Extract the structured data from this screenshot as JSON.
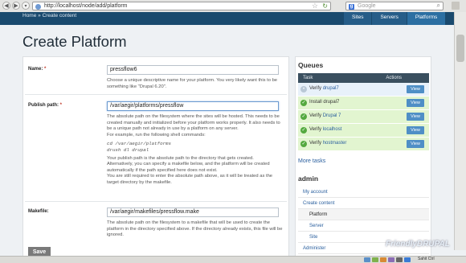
{
  "browser": {
    "url": "http://localhost/node/add/platform",
    "search_placeholder": "Google",
    "search_engine_letter": "g"
  },
  "breadcrumb": "Home » Create content",
  "tabs": [
    "Sites",
    "Servers",
    "Platforms"
  ],
  "page_title": "Create Platform",
  "form": {
    "name": {
      "label": "Name:",
      "value": "pressflow6",
      "description": "Choose a unique descriptive name for your platform. You very likely want this to be something like \"Drupal 6.20\"."
    },
    "publish_path": {
      "label": "Publish path:",
      "value": "/var/aegir/platforms/pressflow",
      "desc1": "The absolute path on the filesystem where the sites will be hosted. This needs to be created manually and initialized before your platform works properly. It also needs to be a unique path not already in use by a platform on any server.",
      "desc2": "For example, run the following shell commands:",
      "code1": "cd /var/aegir/platforms",
      "code2": "drush dl drupal",
      "desc3": "Your publish path is the absolute path to the directory that gets created.",
      "desc4": "Alternatively, you can specify a makefile below, and the platform will be created automatically if the path specified here does not exist.",
      "desc5": "You are still required to enter the absolute path above, as it will be treated as the target directory by the makefile."
    },
    "makefile": {
      "label": "Makefile:",
      "value": "/var/aegir/makefiles/pressflow.make",
      "description": "The absolute path on the filesystem to a makefile that will be used to create the platform in the directory specified above. If the directory already exists, this file will be ignored."
    },
    "required_mark": "*",
    "save_label": "Save"
  },
  "queues": {
    "heading": "Queues",
    "col_task": "Task",
    "col_actions": "Actions",
    "items": [
      {
        "label": "Verify",
        "link": "drupal7",
        "status": "queued",
        "action": "View"
      },
      {
        "label": "Install drupal7",
        "link": "",
        "status": "done",
        "action": "View"
      },
      {
        "label": "Verify",
        "link": "Drupal 7",
        "status": "done",
        "action": "View"
      },
      {
        "label": "Verify",
        "link": "localhost",
        "status": "done",
        "action": "View"
      },
      {
        "label": "Verify",
        "link": "hostmaster",
        "status": "done",
        "action": "View"
      }
    ],
    "more_label": "More tasks"
  },
  "admin": {
    "heading": "admin",
    "items": [
      {
        "label": "My account",
        "level": 0
      },
      {
        "label": "Create content",
        "level": 0
      },
      {
        "label": "Platform",
        "level": 1,
        "current": true
      },
      {
        "label": "Server",
        "level": 1
      },
      {
        "label": "Site",
        "level": 1
      },
      {
        "label": "Administer",
        "level": 0
      }
    ]
  },
  "logo": {
    "text1": "Friendly",
    "text2": "DRUPAL"
  },
  "status_bar": {
    "text": "Sahit Ctrl"
  },
  "colors": {
    "top_nav": "#1a4a6e",
    "queue_done": "#e2f5d0",
    "queue_queued": "#e8f1fa",
    "view_button": "#4f8fc6"
  }
}
